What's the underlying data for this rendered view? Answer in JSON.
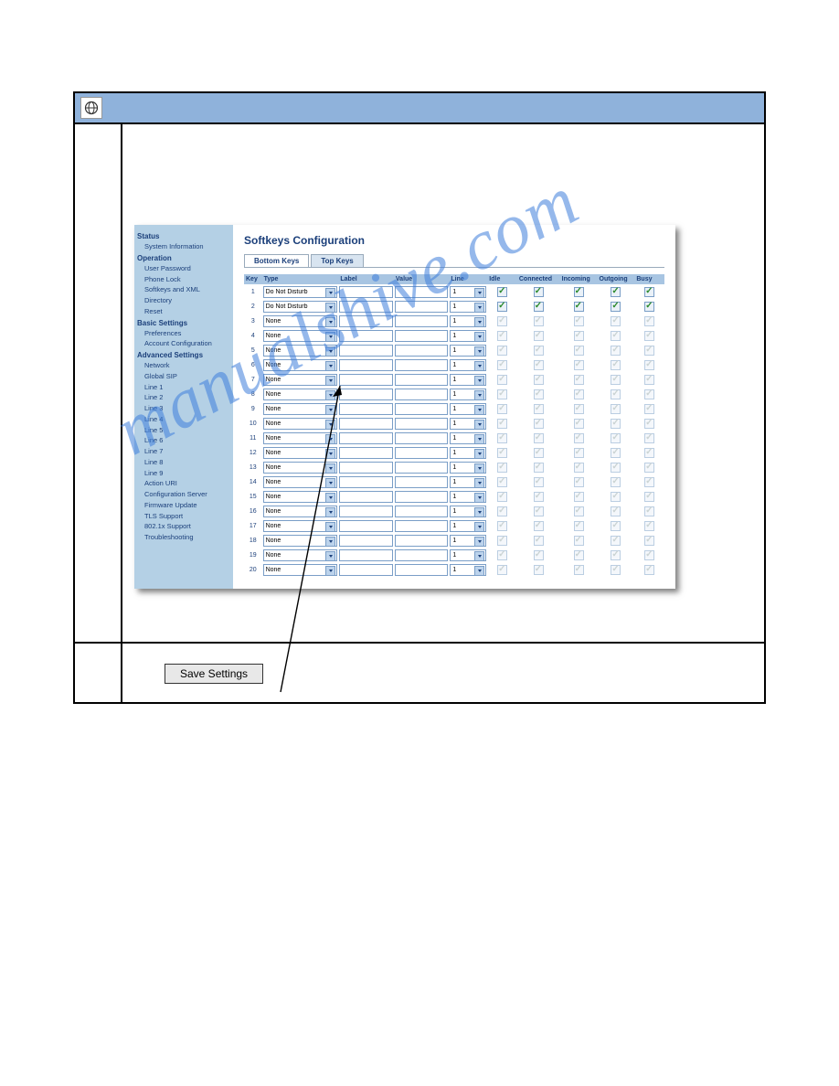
{
  "watermark": "manualshive.com",
  "save_button": "Save Settings",
  "page_title": "Softkeys Configuration",
  "tabs": {
    "bottom": "Bottom Keys",
    "top": "Top Keys"
  },
  "sidebar": {
    "groups": [
      {
        "heading": "Status",
        "items": [
          "System Information"
        ]
      },
      {
        "heading": "Operation",
        "items": [
          "User Password",
          "Phone Lock",
          "Softkeys and XML",
          "Directory",
          "Reset"
        ]
      },
      {
        "heading": "Basic Settings",
        "items": [
          "Preferences",
          "Account Configuration"
        ]
      },
      {
        "heading": "Advanced Settings",
        "items": [
          "Network",
          "Global SIP",
          "Line 1",
          "Line 2",
          "Line 3",
          "Line 4",
          "Line 5",
          "Line 6",
          "Line 7",
          "Line 8",
          "Line 9",
          "Action URI",
          "Configuration Server",
          "Firmware Update",
          "TLS Support",
          "802.1x Support",
          "Troubleshooting"
        ]
      }
    ]
  },
  "columns": {
    "key": "Key",
    "type": "Type",
    "label": "Label",
    "value": "Value",
    "line": "Line",
    "idle": "Idle",
    "connected": "Connected",
    "incoming": "Incoming",
    "outgoing": "Outgoing",
    "busy": "Busy"
  },
  "type_options": {
    "dnd": "Do Not Disturb",
    "none": "None"
  },
  "line_default": "1",
  "rows": [
    {
      "n": 1,
      "type": "dnd",
      "active": true
    },
    {
      "n": 2,
      "type": "dnd",
      "active": true
    },
    {
      "n": 3,
      "type": "none",
      "active": false
    },
    {
      "n": 4,
      "type": "none",
      "active": false
    },
    {
      "n": 5,
      "type": "none",
      "active": false
    },
    {
      "n": 6,
      "type": "none",
      "active": false
    },
    {
      "n": 7,
      "type": "none",
      "active": false
    },
    {
      "n": 8,
      "type": "none",
      "active": false
    },
    {
      "n": 9,
      "type": "none",
      "active": false
    },
    {
      "n": 10,
      "type": "none",
      "active": false
    },
    {
      "n": 11,
      "type": "none",
      "active": false
    },
    {
      "n": 12,
      "type": "none",
      "active": false
    },
    {
      "n": 13,
      "type": "none",
      "active": false
    },
    {
      "n": 14,
      "type": "none",
      "active": false
    },
    {
      "n": 15,
      "type": "none",
      "active": false
    },
    {
      "n": 16,
      "type": "none",
      "active": false
    },
    {
      "n": 17,
      "type": "none",
      "active": false
    },
    {
      "n": 18,
      "type": "none",
      "active": false
    },
    {
      "n": 19,
      "type": "none",
      "active": false
    },
    {
      "n": 20,
      "type": "none",
      "active": false
    }
  ]
}
